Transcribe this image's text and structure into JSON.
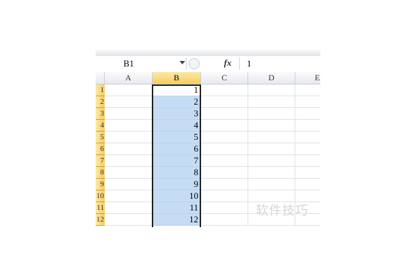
{
  "formula_bar": {
    "name_box": "B1",
    "fx_icon": "fx",
    "formula_value": "1"
  },
  "columns": [
    "A",
    "B",
    "C",
    "D",
    "E"
  ],
  "selected_column": "B",
  "row_headers": [
    "1",
    "2",
    "3",
    "4",
    "5",
    "6",
    "7",
    "8",
    "9",
    "10",
    "11",
    "12"
  ],
  "column_b_values": [
    "1",
    "2",
    "3",
    "4",
    "5",
    "6",
    "7",
    "8",
    "9",
    "10",
    "11",
    "12"
  ],
  "watermark": "软件技巧",
  "colors": {
    "selection_fill": "#c6dcf5",
    "header_highlight": "#f6cc5d",
    "selection_border": "#1f1f1f"
  }
}
